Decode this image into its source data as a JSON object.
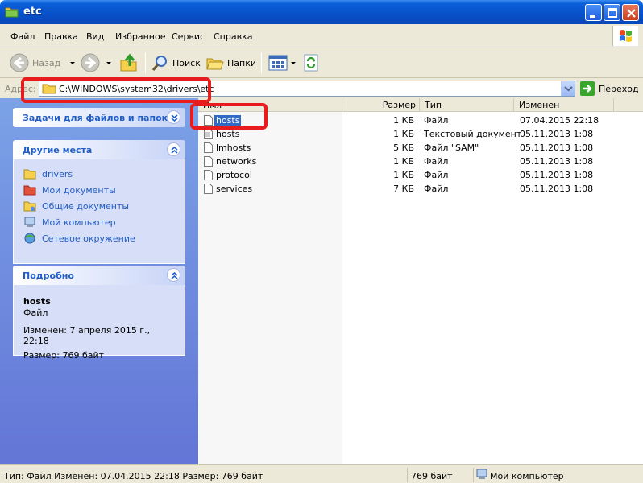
{
  "window": {
    "title": "etc"
  },
  "menu": [
    "Файл",
    "Правка",
    "Вид",
    "Избранное",
    "Сервис",
    "Справка"
  ],
  "toolbar": {
    "back": "Назад",
    "search": "Поиск",
    "folders": "Папки"
  },
  "address": {
    "label": "Адрес:",
    "path": "C:\\WINDOWS\\system32\\drivers\\etc",
    "go": "Переход"
  },
  "tasks": {
    "title": "Задачи для файлов и папок"
  },
  "other_places": {
    "title": "Другие места",
    "items": [
      "drivers",
      "Мои документы",
      "Общие документы",
      "Мой компьютер",
      "Сетевое окружение"
    ]
  },
  "details": {
    "title": "Подробно",
    "name": "hosts",
    "type": "Файл",
    "modified": "Изменен: 7 апреля 2015 г., 22:18",
    "size": "Размер: 769 байт"
  },
  "columns": {
    "name": "Имя",
    "size": "Размер",
    "type": "Тип",
    "modified": "Изменен"
  },
  "files": [
    {
      "name": "hosts",
      "size": "1 КБ",
      "type": "Файл",
      "modified": "07.04.2015 22:18"
    },
    {
      "name": "hosts",
      "size": "1 КБ",
      "type": "Текстовый документ",
      "modified": "05.11.2013 1:08"
    },
    {
      "name": "lmhosts",
      "size": "5 КБ",
      "type": "Файл \"SAM\"",
      "modified": "05.11.2013 1:08"
    },
    {
      "name": "networks",
      "size": "1 КБ",
      "type": "Файл",
      "modified": "05.11.2013 1:08"
    },
    {
      "name": "protocol",
      "size": "1 КБ",
      "type": "Файл",
      "modified": "05.11.2013 1:08"
    },
    {
      "name": "services",
      "size": "7 КБ",
      "type": "Файл",
      "modified": "05.11.2013 1:08"
    }
  ],
  "status": {
    "info": "Тип: Файл Изменен: 07.04.2015 22:18 Размер: 769 байт",
    "size": "769 байт",
    "location": "Мой компьютер"
  },
  "colors": {
    "title_bar": "#0a5fd8",
    "selection": "#316ac5",
    "link": "#215dc6",
    "highlight": "#e81c1c"
  }
}
